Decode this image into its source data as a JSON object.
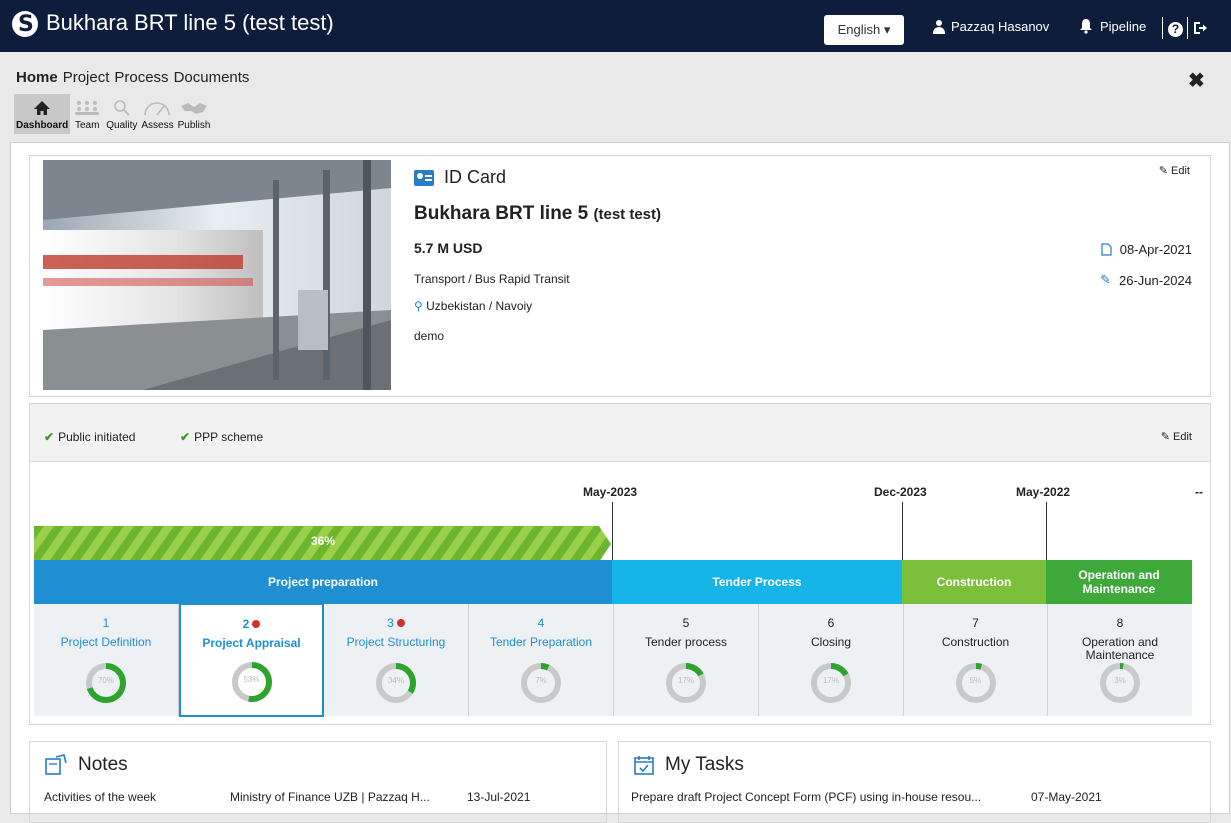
{
  "header": {
    "app_title": "Bukhara BRT line 5 (test test)",
    "language": "English",
    "user": "Pazzaq Hasanov",
    "pipeline": "Pipeline"
  },
  "nav": {
    "main": [
      "Home",
      "Project",
      "Process",
      "Documents"
    ],
    "sub": [
      "Dashboard",
      "Team",
      "Quality",
      "Assess",
      "Publish"
    ]
  },
  "idcard": {
    "heading": "ID Card",
    "edit": "Edit",
    "name": "Bukhara BRT line 5",
    "name_suffix": "(test test)",
    "amount": "5.7 M USD",
    "sector": "Transport / Bus Rapid Transit",
    "location": "Uzbekistan / Navoiy",
    "tag": "demo",
    "created": "08-Apr-2021",
    "modified": "26-Jun-2024"
  },
  "timeline": {
    "checks": [
      "Public initiated",
      "PPP scheme"
    ],
    "edit": "Edit",
    "milestones": [
      "May-2023",
      "Dec-2023",
      "May-2022",
      "--"
    ],
    "progress_pct": 36,
    "progress_label": "36%",
    "phases": [
      {
        "name": "Project preparation",
        "color": "#1f8fd1"
      },
      {
        "name": "Tender Process",
        "color": "#16b5e8"
      },
      {
        "name": "Construction",
        "color": "#7cbf3a"
      },
      {
        "name": "Operation and Maintenance",
        "color": "#3fa83b"
      }
    ],
    "stages": [
      {
        "num": "1",
        "name": "Project Definition",
        "pct": 70,
        "pct_label": "70%"
      },
      {
        "num": "2",
        "name": "Project Appraisal",
        "pct": 53,
        "pct_label": "53%"
      },
      {
        "num": "3",
        "name": "Project Structuring",
        "pct": 34,
        "pct_label": "34%"
      },
      {
        "num": "4",
        "name": "Tender Preparation",
        "pct": 7,
        "pct_label": "7%"
      },
      {
        "num": "5",
        "name": "Tender process",
        "pct": 17,
        "pct_label": "17%"
      },
      {
        "num": "6",
        "name": "Closing",
        "pct": 17,
        "pct_label": "17%"
      },
      {
        "num": "7",
        "name": "Construction",
        "pct": 5,
        "pct_label": "5%"
      },
      {
        "num": "8",
        "name": "Operation and Maintenance",
        "pct": 3,
        "pct_label": "3%"
      }
    ]
  },
  "notes": {
    "title": "Notes",
    "row": {
      "text": "Activities of the week",
      "author": "Ministry of Finance UZB | Pazzaq H...",
      "date": "13-Jul-2021"
    }
  },
  "tasks": {
    "title": "My Tasks",
    "row": {
      "text": "Prepare draft Project Concept Form (PCF) using in-house resou...",
      "date": "07-May-2021"
    }
  },
  "colors": {
    "header_bg": "#0f1d3d",
    "accent_blue": "#1f8fd1",
    "progress_green": "#7cbf3a",
    "donut_green": "#2ea32e"
  }
}
